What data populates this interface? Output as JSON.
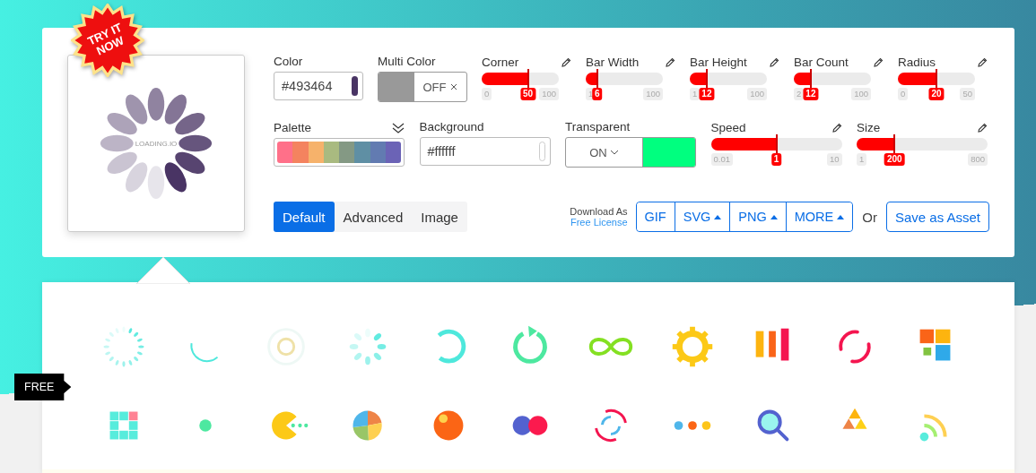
{
  "badge": "TRY IT NOW",
  "preview": {
    "text": "LOADING.IO",
    "color": "#493464"
  },
  "color_field": {
    "label": "Color",
    "value": "#493464",
    "color": "#493464"
  },
  "multi_color": {
    "label": "Multi Color",
    "on": false,
    "text": "OFF"
  },
  "sliders_top": [
    {
      "label": "Corner",
      "level": 0.6,
      "min": "0",
      "value": "50",
      "max": "100"
    },
    {
      "label": "Bar Width",
      "level": 0.15,
      "min": "1",
      "value": "6",
      "max": "100"
    },
    {
      "label": "Bar Height",
      "level": 0.22,
      "min": "1",
      "value": "12",
      "max": "100"
    },
    {
      "label": "Bar Count",
      "level": 0.22,
      "min": "2",
      "value": "12",
      "max": "100"
    },
    {
      "label": "Radius",
      "level": 0.5,
      "min": "0",
      "value": "20",
      "max": "50"
    }
  ],
  "palette": {
    "label": "Palette",
    "colors": [
      {
        "color": "#ff7089"
      },
      {
        "color": "#f4835f"
      },
      {
        "color": "#f6b26b"
      },
      {
        "color": "#a9ba80"
      },
      {
        "color": "#849984"
      },
      {
        "color": "#5f8fa4"
      },
      {
        "color": "#627bb1"
      },
      {
        "color": "#6b63b6"
      }
    ]
  },
  "background_field": {
    "label": "Background",
    "value": "#ffffff",
    "color": "#ffffff"
  },
  "transparent": {
    "label": "Transparent",
    "on": true,
    "text": "ON",
    "color": "#00ff7f"
  },
  "sliders_bottom": [
    {
      "label": "Speed",
      "level": 0.5,
      "min": "0.01",
      "value": "1",
      "max": "10"
    },
    {
      "label": "Size",
      "level": 0.29,
      "min": "1",
      "value": "200",
      "max": "800"
    }
  ],
  "tabs": [
    {
      "label": "Default",
      "selected": true
    },
    {
      "label": "Advanced",
      "selected": false
    },
    {
      "label": "Image",
      "selected": false
    }
  ],
  "download": {
    "label": "Download As",
    "link": "Free License"
  },
  "formats": [
    {
      "label": "GIF",
      "menu": false
    },
    {
      "label": "SVG",
      "menu": true
    },
    {
      "label": "PNG",
      "menu": true
    },
    {
      "label": "MORE",
      "menu": true
    }
  ],
  "or_text": "Or",
  "save_button": "Save as Asset",
  "free_tag": "FREE"
}
